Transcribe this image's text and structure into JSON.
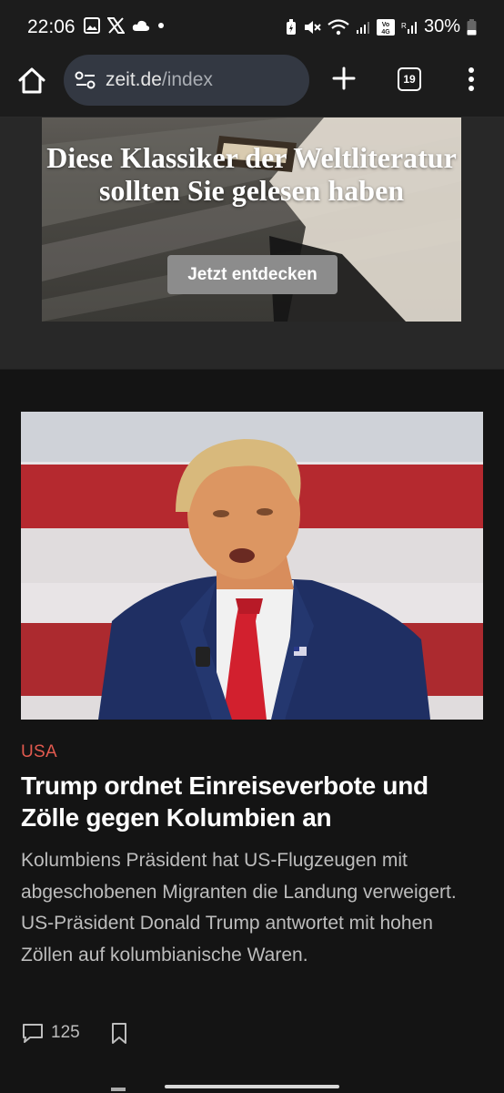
{
  "status_bar": {
    "time": "22:06",
    "left_icons": [
      "gallery-icon",
      "x-logo-icon",
      "cloud-icon",
      "dot-icon"
    ],
    "right_icons": [
      "battery-saver-icon",
      "mute-icon",
      "wifi-icon",
      "signal-icon",
      "volte-icon",
      "signal-r-icon"
    ],
    "battery": "30%"
  },
  "browser": {
    "url_domain": "zeit.de",
    "url_path": "/index",
    "tab_count": "19",
    "icons": [
      "home-icon",
      "tune-icon",
      "plus-icon",
      "tabs-icon",
      "more-vert-icon"
    ]
  },
  "ad": {
    "headline": "Diese Klassiker der Weltliteratur sollten Sie gelesen haben",
    "button": "Jetzt entdecken"
  },
  "article": {
    "kicker": "USA",
    "headline": "Trump ordnet Einreiseverbote und Zölle gegen Kolumbien an",
    "teaser": "Kolumbiens Präsident hat US-Flugzeugen mit abgeschobenen Migranten die Landung verweigert. US-Präsident Donald Trump antwortet mit hohen Zöllen auf kolumbianische Waren.",
    "comment_count": "125"
  },
  "colors": {
    "kicker": "#e25a4f",
    "background": "#141414",
    "ad_background": "#282828",
    "url_box": "#333842"
  }
}
